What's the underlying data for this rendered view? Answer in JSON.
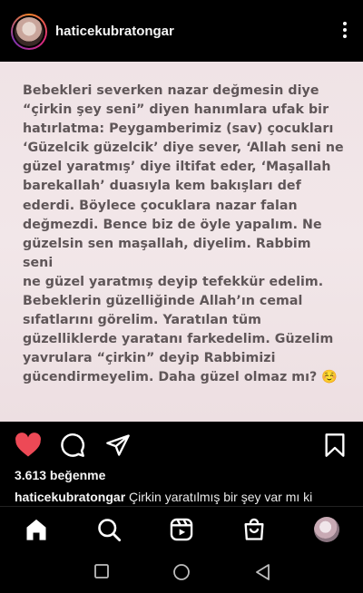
{
  "header": {
    "username": "haticekubratongar",
    "avatar_icon": "profile-avatar",
    "more_icon": "more-vertical-icon"
  },
  "post": {
    "lines": [
      "Bebekleri severken nazar değmesin diye",
      "“çirkin şey seni” diyen hanımlara ufak bir",
      "hatırlatma: Peygamberimiz (sav) çocukları",
      "‘Güzelcik güzelcik’ diye sever, ‘Allah seni ne",
      "güzel yaratmış’ diye iltifat eder, ‘Maşallah",
      "barekallah’ duasıyla kem bakışları def",
      "ederdi. Böylece çocuklara nazar falan",
      "değmezdi. Bence biz de öyle yapalım. Ne",
      "güzelsin sen maşallah, diyelim. Rabbim seni",
      "ne güzel yaratmış deyip tefekkür edelim.",
      "Bebeklerin güzelliğinde Allah’ın cemal",
      "sıfatlarını görelim. Yaratılan tüm",
      "güzelliklerde yaratanı farkedelim. Güzelim",
      "yavrulara “çirkin” deyip Rabbimizi",
      "gücendirmeyelim. Daha güzel olmaz mı? ☺️"
    ]
  },
  "actions": {
    "like_icon": "heart-filled-icon",
    "comment_icon": "comment-icon",
    "share_icon": "send-icon",
    "save_icon": "bookmark-icon",
    "like_color": "#ed4956"
  },
  "likes": "3.613 beğenme",
  "caption": {
    "username": "haticekubratongar",
    "text": "Çirkin yaratılmış bir şey var mı ki"
  },
  "bottom_nav": [
    "home-icon",
    "search-icon",
    "reels-icon",
    "shop-icon",
    "profile-icon"
  ],
  "system_nav": [
    "recents-square-icon",
    "home-circle-icon",
    "back-triangle-icon"
  ]
}
